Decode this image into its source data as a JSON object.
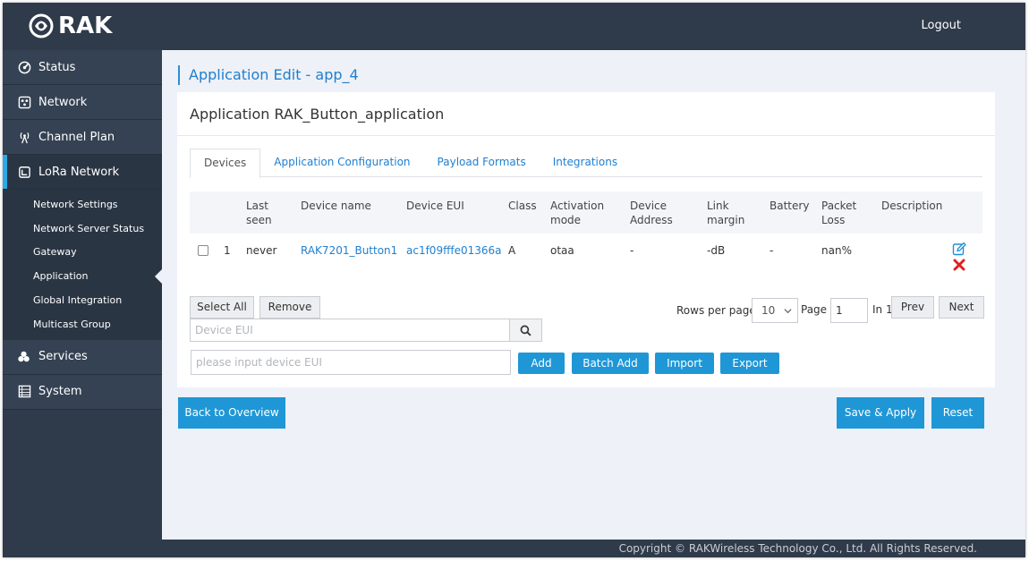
{
  "brand": {
    "logo_text": "RAK"
  },
  "header": {
    "logout_label": "Logout"
  },
  "sidebar": {
    "items": [
      {
        "label": "Status",
        "icon": "status-icon"
      },
      {
        "label": "Network",
        "icon": "network-icon"
      },
      {
        "label": "Channel Plan",
        "icon": "antenna-icon"
      },
      {
        "label": "LoRa Network",
        "icon": "lora-icon"
      },
      {
        "label": "Services",
        "icon": "services-icon"
      },
      {
        "label": "System",
        "icon": "system-icon"
      }
    ],
    "subitems": [
      {
        "label": "Network Settings"
      },
      {
        "label": "Network Server Status"
      },
      {
        "label": "Gateway"
      },
      {
        "label": "Application"
      },
      {
        "label": "Global Integration"
      },
      {
        "label": "Multicast Group"
      }
    ]
  },
  "page": {
    "title": "Application Edit - app_4"
  },
  "card": {
    "title": "Application RAK_Button_application"
  },
  "tabs": [
    {
      "label": "Devices"
    },
    {
      "label": "Application Configuration"
    },
    {
      "label": "Payload Formats"
    },
    {
      "label": "Integrations"
    }
  ],
  "table": {
    "headers": {
      "last_seen_1": "Last",
      "last_seen_2": "seen",
      "device_name": "Device name",
      "device_eui": "Device EUI",
      "class": "Class",
      "activation_1": "Activation",
      "activation_2": "mode",
      "address_1": "Device",
      "address_2": "Address",
      "link_1": "Link",
      "link_2": "margin",
      "battery": "Battery",
      "packet_1": "Packet",
      "packet_2": "Loss",
      "description": "Description"
    },
    "rows": [
      {
        "index": "1",
        "last_seen": "never",
        "device_name": "RAK7201_Button1",
        "device_eui": "ac1f09fffe01366a",
        "class": "A",
        "activation": "otaa",
        "address": "-",
        "link_margin": "-dB",
        "battery": "-",
        "packet_loss": "nan%",
        "description": ""
      }
    ]
  },
  "controls": {
    "select_all": "Select All",
    "remove": "Remove",
    "rows_per_page_label": "Rows per page",
    "rows_per_page_value": "10",
    "page_label": "Page",
    "page_value": "1",
    "in_label": "In 1",
    "prev": "Prev",
    "next": "Next",
    "search_placeholder": "Device EUI",
    "eui_placeholder": "please input device EUI",
    "add": "Add",
    "batch_add": "Batch Add",
    "import": "Import",
    "export": "Export"
  },
  "actions": {
    "back": "Back to Overview",
    "save": "Save & Apply",
    "reset": "Reset"
  },
  "footer": {
    "copyright": "Copyright © RAKWireless Technology Co., Ltd. All Rights Reserved."
  },
  "colors": {
    "accent": "#1f97d6",
    "link": "#1f7fcf",
    "sidebar": "#2f3b4a",
    "delete": "#e02020"
  }
}
